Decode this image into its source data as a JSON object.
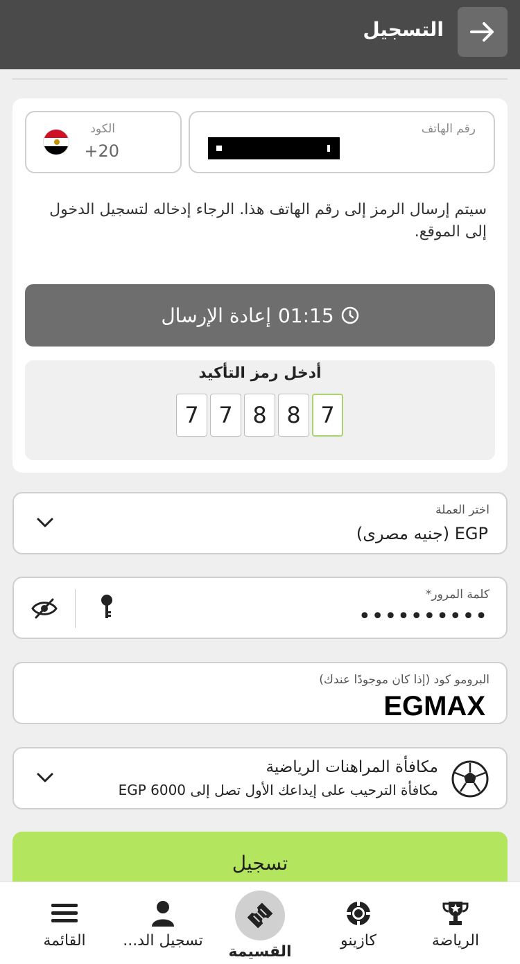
{
  "header": {
    "title": "التسجيل"
  },
  "phone": {
    "label": "رقم الهاتف",
    "code_label": "الكود",
    "code_value": "+20"
  },
  "info_text": "سيتم إرسال الرمز إلى رقم الهاتف هذا. الرجاء إدخاله لتسجيل الدخول إلى الموقع.",
  "resend": {
    "timer": "01:15",
    "label": "إعادة الإرسال"
  },
  "otp": {
    "label": "أدخل رمز التأكيد",
    "digits": [
      "7",
      "7",
      "8",
      "8",
      "7"
    ]
  },
  "currency": {
    "label": "اختر العملة",
    "value": "EGP  (جنيه مصرى)"
  },
  "password": {
    "label": "كلمة المرور*",
    "value": "••••••••••"
  },
  "promo": {
    "label": "البرومو كود (إذا كان موجودًا عندك)",
    "value": "EGMAX"
  },
  "bonus": {
    "title": "مكافأة المراهنات الرياضية",
    "subtitle": "مكافأة الترحيب على إيداعك الأول تصل إلى EGP 6000"
  },
  "register_label": "تسجيل",
  "nav": {
    "menu": "القائمة",
    "login": "تسجيل الد...",
    "betslip": "القسيمة",
    "casino": "كازينو",
    "sports": "الرياضة"
  },
  "colors": {
    "header_bg": "#4a4a4a",
    "accent_green": "#b4e55f",
    "resend_bg": "#6e6e6e"
  }
}
